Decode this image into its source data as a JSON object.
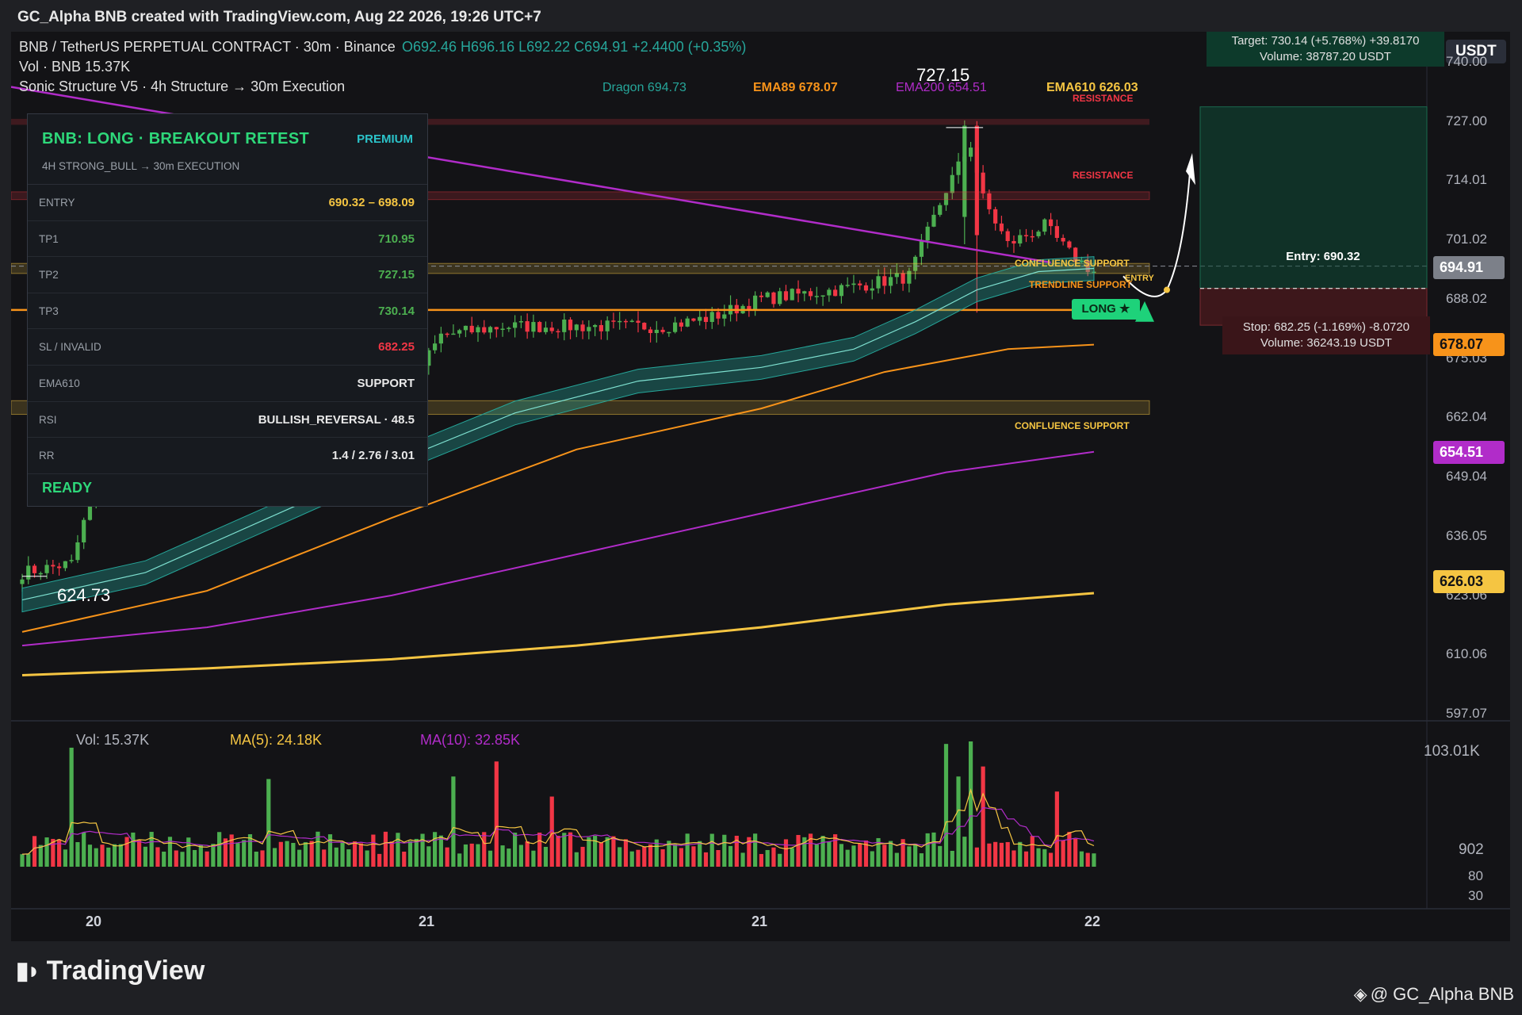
{
  "window": {
    "title": "GC_Alpha BNB created with TradingView.com, Aug 22 2026, 19:26 UTC+7"
  },
  "legend": {
    "symbol": "BNB / TetherUS PERPETUAL CONTRACT · 30m · Binance",
    "ohlc": "O692.46 H696.16 L692.22 C694.91 +2.4400 (+0.35%)",
    "vol": "Vol · BNB  15.37K",
    "indicator": "Sonic Structure V5 · 4h Structure → 30m Execution"
  },
  "ma_labels": {
    "dragon": "Dragon 694.73",
    "ema89": "EMA89 678.07",
    "ema200": "EMA200 654.51",
    "ema610": "EMA610 626.03"
  },
  "panel": {
    "signal": "BNB: LONG · BREAKOUT RETEST",
    "badge": "PREMIUM",
    "subtitle": "4H STRONG_BULL → 30m EXECUTION",
    "rows": [
      {
        "key": "ENTRY",
        "value": "690.32 – 698.09",
        "color": "#f5c542"
      },
      {
        "key": "TP1",
        "value": "710.95",
        "color": "#4caf50"
      },
      {
        "key": "TP2",
        "value": "727.15",
        "color": "#4caf50"
      },
      {
        "key": "TP3",
        "value": "730.14",
        "color": "#4caf50"
      },
      {
        "key": "SL / INVALID",
        "value": "682.25",
        "color": "#f23645"
      },
      {
        "key": "EMA610",
        "value": "SUPPORT",
        "color": "#e8e8e8"
      },
      {
        "key": "RSI",
        "value": "BULLISH_REVERSAL · 48.5",
        "color": "#e8e8e8"
      },
      {
        "key": "RR",
        "value": "1.4 / 2.76 / 3.01",
        "color": "#e8e8e8"
      }
    ],
    "status": "READY"
  },
  "annotations": {
    "high": "727.15",
    "low": "624.73",
    "resistance1": "RESISTANCE",
    "resistance2": "RESISTANCE",
    "confluence1": "CONFLUENCE SUPPORT",
    "trendline": "TRENDLINE SUPPORT",
    "confluence2": "CONFLUENCE SUPPORT",
    "entry": "ENTRY",
    "long": "LONG ★"
  },
  "position": {
    "target_line1": "Target: 730.14 (+5.768%)  +39.8170",
    "target_line2": "Volume: 38787.20 USDT",
    "entry": "Entry: 690.32",
    "stop_line1": "Stop: 682.25  (-1.169%)  -8.0720",
    "stop_line2": "Volume: 36243.19 USDT"
  },
  "price_axis": {
    "currency": "USDT",
    "ticks": [
      "740.00",
      "727.00",
      "714.01",
      "701.02",
      "688.02",
      "675.03",
      "662.04",
      "649.04",
      "636.05",
      "623.06",
      "610.06",
      "597.07"
    ],
    "tags": [
      {
        "label": "694.91",
        "bg": "#7c8089",
        "fg": "#ffffff",
        "price": 694.91
      },
      {
        "label": "678.07",
        "bg": "#f7931a",
        "fg": "#131316",
        "price": 678.07
      },
      {
        "label": "654.51",
        "bg": "#b12cc9",
        "fg": "#ffffff",
        "price": 654.51
      },
      {
        "label": "626.03",
        "bg": "#f5c542",
        "fg": "#131316",
        "price": 626.03
      }
    ]
  },
  "volume_pane": {
    "vol": "Vol: 15.37K",
    "ma5": "MA(5): 24.18K",
    "ma10": "MA(10): 32.85K",
    "ticks": [
      "103.01K",
      "902",
      "80",
      "30"
    ]
  },
  "time_axis": {
    "labels": [
      "20",
      "21",
      "21",
      "22"
    ]
  },
  "footer": {
    "brand": "TradingView",
    "handle": "@ GC_Alpha BNB"
  },
  "colors": {
    "up": "#4caf50",
    "down": "#f23645",
    "ema89": "#f7931a",
    "ema200": "#b12cc9",
    "ema610": "#f5c542",
    "dragon": "#26a69a",
    "trend": "#b12cc9"
  },
  "chart_data": {
    "type": "candlestick",
    "y_range": [
      597.07,
      740.0
    ],
    "candles_approx": [
      [
        628,
        627,
        629,
        626
      ],
      [
        627,
        628,
        629,
        625
      ],
      [
        628,
        629,
        630,
        627
      ],
      [
        629,
        631,
        632,
        628
      ],
      [
        631,
        630,
        632,
        629
      ],
      [
        630,
        633,
        634,
        629
      ],
      [
        633,
        634,
        635,
        632
      ],
      [
        634,
        636,
        637,
        633
      ],
      [
        636,
        648,
        650,
        635
      ],
      [
        648,
        646,
        650,
        644
      ]
    ],
    "volume_ma5": 24180,
    "volume_ma10": 32850,
    "last_close": 694.91
  }
}
